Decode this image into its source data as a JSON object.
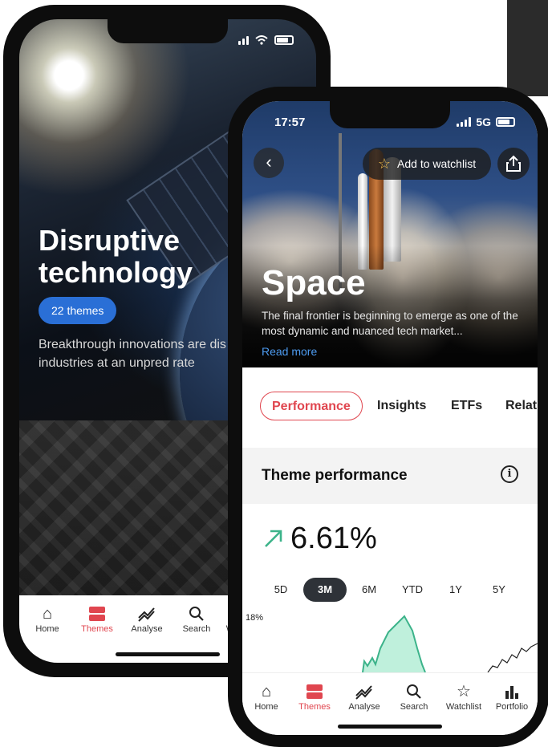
{
  "back_phone": {
    "title": "Disruptive technology",
    "badge": "22 themes",
    "description": "Breakthrough innovations are dis stagnant industries at an unpred rate",
    "tabbar": [
      {
        "label": "Home",
        "icon": "home-icon"
      },
      {
        "label": "Themes",
        "icon": "themes-icon",
        "active": true
      },
      {
        "label": "Analyse",
        "icon": "analyse-icon"
      },
      {
        "label": "Search",
        "icon": "search-icon"
      },
      {
        "label": "W",
        "icon": "watchlist-icon"
      }
    ]
  },
  "front_phone": {
    "status": {
      "time": "17:57",
      "network": "5G"
    },
    "header": {
      "watchlist_label": "Add to watchlist"
    },
    "hero": {
      "title": "Space",
      "description": "The final frontier is beginning to emerge as one of the most dynamic and nuanced tech market...",
      "read_more": "Read more"
    },
    "tabs": [
      {
        "label": "Performance",
        "active": true
      },
      {
        "label": "Insights"
      },
      {
        "label": "ETFs"
      },
      {
        "label": "Relat"
      }
    ],
    "section": {
      "title": "Theme performance"
    },
    "performance": {
      "value": "6.61%",
      "direction": "up",
      "color": "#3cb38a"
    },
    "periods": [
      {
        "label": "5D"
      },
      {
        "label": "3M",
        "active": true
      },
      {
        "label": "6M"
      },
      {
        "label": "YTD"
      },
      {
        "label": "1Y"
      },
      {
        "label": "5Y"
      }
    ],
    "chart": {
      "y_label": "18%",
      "fill_color": "#bff0dc",
      "line_color": "#3cb38a"
    },
    "tabbar": [
      {
        "label": "Home",
        "icon": "home-icon"
      },
      {
        "label": "Themes",
        "icon": "themes-icon",
        "active": true
      },
      {
        "label": "Analyse",
        "icon": "analyse-icon"
      },
      {
        "label": "Search",
        "icon": "search-icon"
      },
      {
        "label": "Watchlist",
        "icon": "star-icon"
      },
      {
        "label": "Portfolio",
        "icon": "portfolio-icon"
      }
    ]
  },
  "colors": {
    "accent": "#e0464f",
    "badge": "#2a6fd6",
    "link": "#4d9bf0"
  }
}
